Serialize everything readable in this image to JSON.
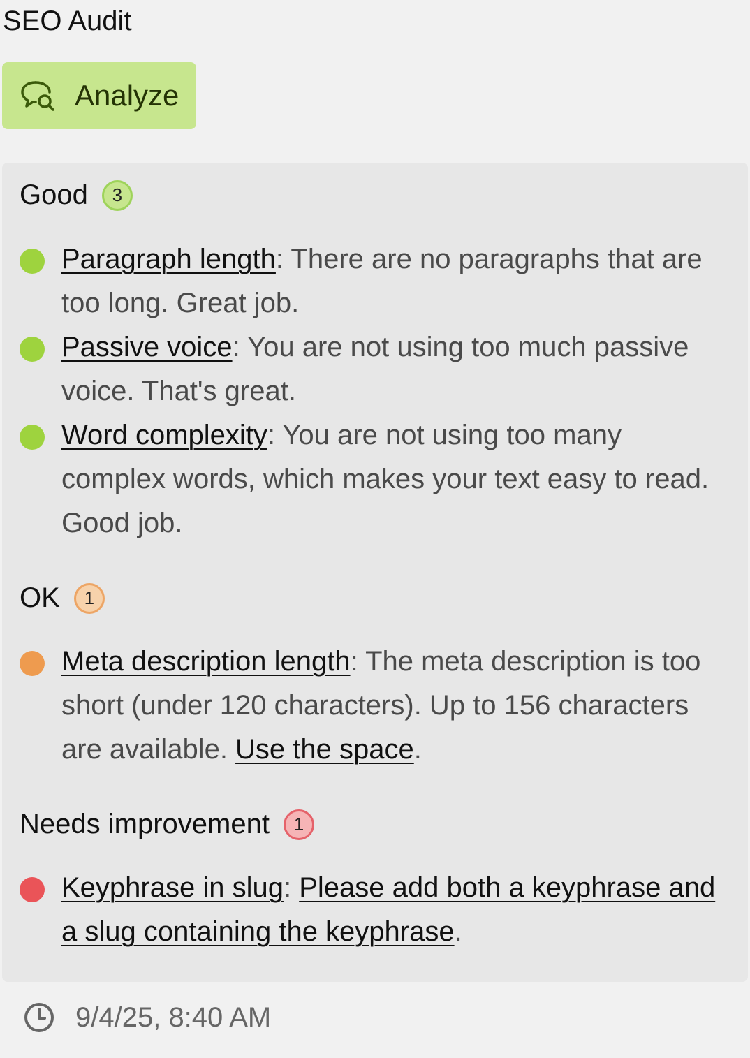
{
  "title": "SEO Audit",
  "analyze_button": {
    "label": "Analyze",
    "icon": "search-chat-icon",
    "color": "#c7e68e"
  },
  "sections": [
    {
      "heading": "Good",
      "count": "3",
      "status_color": "#9ed33e",
      "items": [
        {
          "link": "Paragraph length",
          "sep": ": ",
          "text": "There are no paragraphs that are too long. Great job."
        },
        {
          "link": "Passive voice",
          "sep": ": ",
          "text": "You are not using too much passive voice. That's great."
        },
        {
          "link": "Word complexity",
          "sep": ": ",
          "text": "You are not using too many complex words, which makes your text easy to read. Good job."
        }
      ]
    },
    {
      "heading": "OK",
      "count": "1",
      "status_color": "#ee9b4f",
      "items": [
        {
          "link": "Meta description length",
          "sep": ": ",
          "text": "The meta description is too short (under 120 characters). Up to 156 characters are available. ",
          "action_link": "Use the space",
          "end": "."
        }
      ]
    },
    {
      "heading": "Needs improvement",
      "count": "1",
      "status_color": "#ea5458",
      "items": [
        {
          "link": "Keyphrase in slug",
          "sep": ": ",
          "action_link": "Please add both a keyphrase and a slug containing the keyphrase",
          "end": "."
        }
      ]
    }
  ],
  "timestamp": {
    "icon": "clock-icon",
    "value": "9/4/25, 8:40 AM"
  }
}
